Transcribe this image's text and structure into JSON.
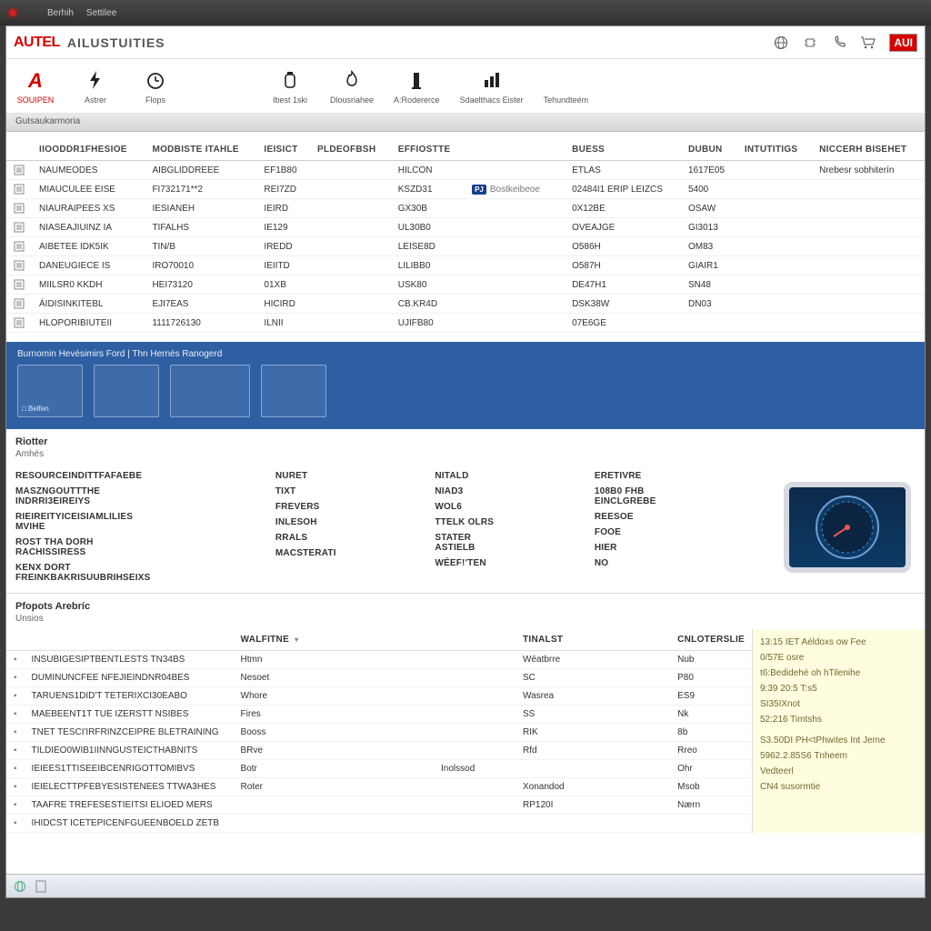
{
  "titlebar": {
    "menu1": "Berhih",
    "menu2": "Settilee"
  },
  "header": {
    "logo": "AUTEL",
    "app": "AILUSTUITIES",
    "badge": "AUI"
  },
  "toolbar": [
    {
      "label": "SOUIPEN",
      "icon": "A"
    },
    {
      "label": "Astrer",
      "icon": "bolt"
    },
    {
      "label": "Flops",
      "icon": "clock"
    },
    {
      "label": "Ibest 1ski",
      "icon": "jar"
    },
    {
      "label": "Dlousriahee",
      "icon": "flame"
    },
    {
      "label": "A:Rodererce",
      "icon": "tower"
    },
    {
      "label": "Sdaelthacs Eister",
      "icon": "bar"
    },
    {
      "label": "Tehundteém",
      "icon": "blank"
    }
  ],
  "statusbar": "Gutsaukarmoria",
  "table": {
    "headers": [
      "IIOODDR1FHESIOE",
      "MODBISTE ITAHLE",
      "IEISICT",
      "PLDEOFBSH",
      "EFFIOSTTE",
      "",
      "BUESS",
      "DUBUN",
      "INTUTITIGS",
      "NICCERH BISEHET"
    ],
    "rows": [
      [
        "NAUMEODES",
        "AIBGLIDDREEE",
        "EF1B80",
        "",
        "HILCON",
        "",
        "ETLAS",
        "1617E05",
        "",
        "Nrebesr sobhiterín"
      ],
      [
        "MIAUCULEE EISE",
        "FI732171**2",
        "REI7ZD",
        "",
        "KSZD31",
        "PJ Bostkeibeoe",
        "02484I1 ERIP LEIZCS",
        "5400",
        "",
        ""
      ],
      [
        "NIAURAIPEES XS",
        "IESIANEH",
        "IEIRD",
        "",
        "GX30B",
        "",
        "0X12BE",
        "OSAW",
        "",
        ""
      ],
      [
        "NIASEAJIUINZ IA",
        "TIFALHS",
        "IE129",
        "",
        "UL30B0",
        "",
        "OVEAJGE",
        "GI3013",
        "",
        ""
      ],
      [
        "AIBETEE IDK5IK",
        "TIN/B",
        "IREDD",
        "",
        "LEISE8D",
        "",
        "O586H",
        "ОМ83",
        "",
        ""
      ],
      [
        "DANEUGIECE IS",
        "IRO70010",
        "IEIITD",
        "",
        "LILIBB0",
        "",
        "O587H",
        "GIAIR1",
        "",
        ""
      ],
      [
        "MIILSR0 KKDH",
        "HEI73120",
        "01XB",
        "",
        "USK80",
        "",
        "DE47H1",
        "SN48",
        "",
        ""
      ],
      [
        "ÁIDISINKITEBL",
        "EJI7EAS",
        "HICIRD",
        "",
        "CB.KR4D",
        "",
        "DSK38W",
        "DN03",
        "",
        ""
      ],
      [
        "HLOPORIBIUTEII",
        "1111726130",
        "ILNII",
        "",
        "UJIFB80",
        "",
        "07E6GE",
        "",
        "",
        ""
      ]
    ]
  },
  "bluebar": {
    "title": "Burnomin Hevésimirs Ford   |   Thn Hernés Ranogerd",
    "thumbs": [
      "□ Belfen",
      "",
      "",
      "",
      ""
    ]
  },
  "section": {
    "title": "Riotter",
    "sub": "Amhés"
  },
  "details": {
    "left": [
      [
        "RESOURCEINDITTFAFAEBE",
        ""
      ],
      [
        "MASZNGOUTTTHE INDRRI3EIREIYS",
        ""
      ],
      [
        "RIEIREITYICEISIAMLILIES MVIHE",
        ""
      ],
      [
        "ROST THA DORH RACHISSIRESS",
        ""
      ],
      [
        "KENX DORT FREINKBAKRISUUBRIHSEIXS",
        ""
      ]
    ],
    "mid": [
      [
        "Nuret",
        ""
      ],
      [
        "TIxT",
        ""
      ],
      [
        "Frevers",
        ""
      ],
      [
        "Inlesoh",
        ""
      ],
      [
        "Rrals",
        ""
      ],
      [
        "Macsterati",
        ""
      ]
    ],
    "right1": [
      [
        "Nitald",
        ""
      ],
      [
        "NIAD3",
        ""
      ],
      [
        "Wol6",
        ""
      ],
      [
        "Ttelk Olrs",
        ""
      ],
      [
        "Stater Astielb",
        ""
      ],
      [
        "Wéef!'Ten",
        ""
      ]
    ],
    "right2": [
      [
        "Eretivre",
        ""
      ],
      [
        "108B0 FHB EINclgrebe",
        ""
      ],
      [
        "Reesoe",
        ""
      ],
      [
        "Fooe",
        ""
      ],
      [
        "Hier",
        ""
      ],
      [
        "No",
        ""
      ]
    ]
  },
  "lower": {
    "section": "Pfopots Arebríc",
    "sub": "Unsios",
    "headers": [
      "",
      "Walfitne",
      "",
      "Tinalst",
      "Cnloterslie"
    ],
    "rows": [
      [
        "INSUBIGESIPTBENTLESTS TN34BS",
        "Htmn",
        "",
        "Wéatbrre",
        "Nub"
      ],
      [
        "DUMINUNCFEE NFEJIEINDNR04BES",
        "Nesoet",
        "",
        "SC",
        "P80"
      ],
      [
        "TARUENS1DID'T TETERIXCI30EABO",
        "Whore",
        "",
        "Wasrea",
        "ES9"
      ],
      [
        "MAEBEENT1T TUE IZERSTT NSIBES",
        "Fires",
        "",
        "SS",
        "Nk"
      ],
      [
        "TNET TESCI'IRFRINZCEIPRE BLETRAINING",
        "Booss",
        "",
        "RIK",
        "8b"
      ],
      [
        "TILDIEO0WIB1IINNGUSTEICTHABNITS",
        "BRve",
        "",
        "Rfd",
        "Rreo"
      ],
      [
        "IEIEES1TTISEEIBCENRIGOTTOMIBVS",
        "Botr",
        "Inolssod",
        "",
        "Ohr"
      ],
      [
        "IEIELECTTPFEBYESISTENEES TTWA3HES",
        "Roter",
        "",
        "Xonandod",
        "Msob"
      ],
      [
        "TAAFRE TREFESESTIEITSI ELIOED MERS",
        "",
        "",
        "RP120I",
        "Nærn"
      ],
      [
        "IHIDCST ICETEPICENFGUEENBOELD ZETB",
        "",
        "",
        "",
        ""
      ]
    ],
    "notes": [
      "13:15 IET Aéldoxs ow Fee",
      "0/57E osre",
      "t6:Bedidehé oh hTilenihe",
      "9:39 20:5 T:s5",
      "SI35IXnot",
      "52:216 Timtshs",
      "",
      "S3.50DI  PH<tPhwites Int Jeme",
      "5962.2.85S6             Tnheem",
      "                    Vedteerl",
      "CN4   susormtie"
    ]
  }
}
